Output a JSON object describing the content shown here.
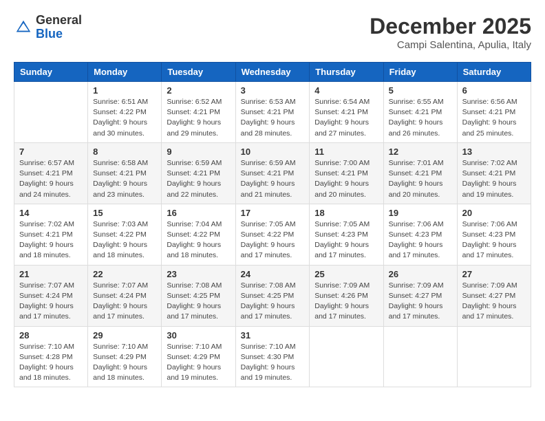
{
  "logo": {
    "general": "General",
    "blue": "Blue"
  },
  "header": {
    "month": "December 2025",
    "location": "Campi Salentina, Apulia, Italy"
  },
  "days_of_week": [
    "Sunday",
    "Monday",
    "Tuesday",
    "Wednesday",
    "Thursday",
    "Friday",
    "Saturday"
  ],
  "weeks": [
    [
      {
        "day": "",
        "sunrise": "",
        "sunset": "",
        "daylight": ""
      },
      {
        "day": "1",
        "sunrise": "Sunrise: 6:51 AM",
        "sunset": "Sunset: 4:22 PM",
        "daylight": "Daylight: 9 hours and 30 minutes."
      },
      {
        "day": "2",
        "sunrise": "Sunrise: 6:52 AM",
        "sunset": "Sunset: 4:21 PM",
        "daylight": "Daylight: 9 hours and 29 minutes."
      },
      {
        "day": "3",
        "sunrise": "Sunrise: 6:53 AM",
        "sunset": "Sunset: 4:21 PM",
        "daylight": "Daylight: 9 hours and 28 minutes."
      },
      {
        "day": "4",
        "sunrise": "Sunrise: 6:54 AM",
        "sunset": "Sunset: 4:21 PM",
        "daylight": "Daylight: 9 hours and 27 minutes."
      },
      {
        "day": "5",
        "sunrise": "Sunrise: 6:55 AM",
        "sunset": "Sunset: 4:21 PM",
        "daylight": "Daylight: 9 hours and 26 minutes."
      },
      {
        "day": "6",
        "sunrise": "Sunrise: 6:56 AM",
        "sunset": "Sunset: 4:21 PM",
        "daylight": "Daylight: 9 hours and 25 minutes."
      }
    ],
    [
      {
        "day": "7",
        "sunrise": "Sunrise: 6:57 AM",
        "sunset": "Sunset: 4:21 PM",
        "daylight": "Daylight: 9 hours and 24 minutes."
      },
      {
        "day": "8",
        "sunrise": "Sunrise: 6:58 AM",
        "sunset": "Sunset: 4:21 PM",
        "daylight": "Daylight: 9 hours and 23 minutes."
      },
      {
        "day": "9",
        "sunrise": "Sunrise: 6:59 AM",
        "sunset": "Sunset: 4:21 PM",
        "daylight": "Daylight: 9 hours and 22 minutes."
      },
      {
        "day": "10",
        "sunrise": "Sunrise: 6:59 AM",
        "sunset": "Sunset: 4:21 PM",
        "daylight": "Daylight: 9 hours and 21 minutes."
      },
      {
        "day": "11",
        "sunrise": "Sunrise: 7:00 AM",
        "sunset": "Sunset: 4:21 PM",
        "daylight": "Daylight: 9 hours and 20 minutes."
      },
      {
        "day": "12",
        "sunrise": "Sunrise: 7:01 AM",
        "sunset": "Sunset: 4:21 PM",
        "daylight": "Daylight: 9 hours and 20 minutes."
      },
      {
        "day": "13",
        "sunrise": "Sunrise: 7:02 AM",
        "sunset": "Sunset: 4:21 PM",
        "daylight": "Daylight: 9 hours and 19 minutes."
      }
    ],
    [
      {
        "day": "14",
        "sunrise": "Sunrise: 7:02 AM",
        "sunset": "Sunset: 4:21 PM",
        "daylight": "Daylight: 9 hours and 18 minutes."
      },
      {
        "day": "15",
        "sunrise": "Sunrise: 7:03 AM",
        "sunset": "Sunset: 4:22 PM",
        "daylight": "Daylight: 9 hours and 18 minutes."
      },
      {
        "day": "16",
        "sunrise": "Sunrise: 7:04 AM",
        "sunset": "Sunset: 4:22 PM",
        "daylight": "Daylight: 9 hours and 18 minutes."
      },
      {
        "day": "17",
        "sunrise": "Sunrise: 7:05 AM",
        "sunset": "Sunset: 4:22 PM",
        "daylight": "Daylight: 9 hours and 17 minutes."
      },
      {
        "day": "18",
        "sunrise": "Sunrise: 7:05 AM",
        "sunset": "Sunset: 4:23 PM",
        "daylight": "Daylight: 9 hours and 17 minutes."
      },
      {
        "day": "19",
        "sunrise": "Sunrise: 7:06 AM",
        "sunset": "Sunset: 4:23 PM",
        "daylight": "Daylight: 9 hours and 17 minutes."
      },
      {
        "day": "20",
        "sunrise": "Sunrise: 7:06 AM",
        "sunset": "Sunset: 4:23 PM",
        "daylight": "Daylight: 9 hours and 17 minutes."
      }
    ],
    [
      {
        "day": "21",
        "sunrise": "Sunrise: 7:07 AM",
        "sunset": "Sunset: 4:24 PM",
        "daylight": "Daylight: 9 hours and 17 minutes."
      },
      {
        "day": "22",
        "sunrise": "Sunrise: 7:07 AM",
        "sunset": "Sunset: 4:24 PM",
        "daylight": "Daylight: 9 hours and 17 minutes."
      },
      {
        "day": "23",
        "sunrise": "Sunrise: 7:08 AM",
        "sunset": "Sunset: 4:25 PM",
        "daylight": "Daylight: 9 hours and 17 minutes."
      },
      {
        "day": "24",
        "sunrise": "Sunrise: 7:08 AM",
        "sunset": "Sunset: 4:25 PM",
        "daylight": "Daylight: 9 hours and 17 minutes."
      },
      {
        "day": "25",
        "sunrise": "Sunrise: 7:09 AM",
        "sunset": "Sunset: 4:26 PM",
        "daylight": "Daylight: 9 hours and 17 minutes."
      },
      {
        "day": "26",
        "sunrise": "Sunrise: 7:09 AM",
        "sunset": "Sunset: 4:27 PM",
        "daylight": "Daylight: 9 hours and 17 minutes."
      },
      {
        "day": "27",
        "sunrise": "Sunrise: 7:09 AM",
        "sunset": "Sunset: 4:27 PM",
        "daylight": "Daylight: 9 hours and 17 minutes."
      }
    ],
    [
      {
        "day": "28",
        "sunrise": "Sunrise: 7:10 AM",
        "sunset": "Sunset: 4:28 PM",
        "daylight": "Daylight: 9 hours and 18 minutes."
      },
      {
        "day": "29",
        "sunrise": "Sunrise: 7:10 AM",
        "sunset": "Sunset: 4:29 PM",
        "daylight": "Daylight: 9 hours and 18 minutes."
      },
      {
        "day": "30",
        "sunrise": "Sunrise: 7:10 AM",
        "sunset": "Sunset: 4:29 PM",
        "daylight": "Daylight: 9 hours and 19 minutes."
      },
      {
        "day": "31",
        "sunrise": "Sunrise: 7:10 AM",
        "sunset": "Sunset: 4:30 PM",
        "daylight": "Daylight: 9 hours and 19 minutes."
      },
      {
        "day": "",
        "sunrise": "",
        "sunset": "",
        "daylight": ""
      },
      {
        "day": "",
        "sunrise": "",
        "sunset": "",
        "daylight": ""
      },
      {
        "day": "",
        "sunrise": "",
        "sunset": "",
        "daylight": ""
      }
    ]
  ]
}
